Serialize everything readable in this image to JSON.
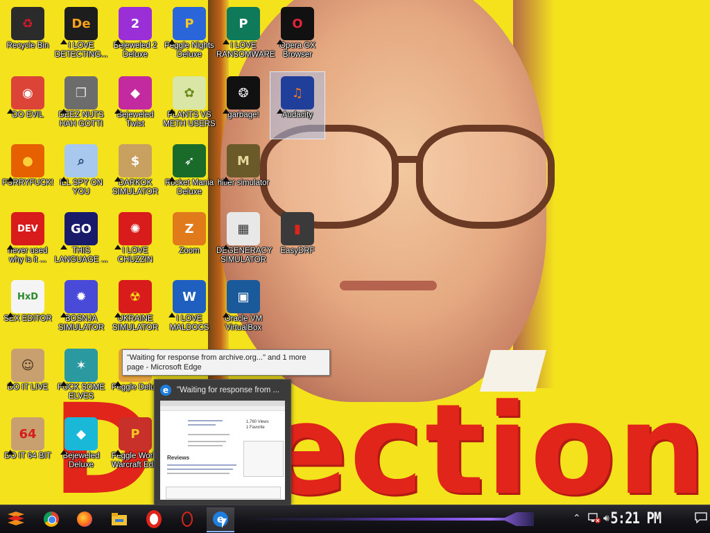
{
  "desktop": {
    "icons": [
      {
        "label": "Recycle Bin",
        "glyph": "recycle-bin-icon",
        "bg": "#2b2b2b",
        "fg": "#d81b2a",
        "text": "♻",
        "shortcut": false
      },
      {
        "label": "I LOVE DETECTING...",
        "glyph": "app-de-icon",
        "bg": "#1d1d1d",
        "fg": "#f7a21b",
        "text": "De",
        "shortcut": true
      },
      {
        "label": "Bejeweled 2 Deluxe",
        "glyph": "bejeweled-2-icon",
        "bg": "#9a2fd8",
        "fg": "#fff",
        "text": "2",
        "shortcut": true
      },
      {
        "label": "Peggle Nights Deluxe",
        "glyph": "peggle-icon",
        "bg": "#2a66d9",
        "fg": "#f7c623",
        "text": "P",
        "shortcut": true
      },
      {
        "label": "I LOVE RANSOMWARE",
        "glyph": "publisher-icon",
        "bg": "#0e7a5a",
        "fg": "#fff",
        "text": "P",
        "shortcut": true
      },
      {
        "label": "Opera GX Browser",
        "glyph": "opera-gx-icon",
        "bg": "#111",
        "fg": "#e0243a",
        "text": "O",
        "shortcut": true
      },
      {
        "label": "DO EVIL",
        "glyph": "chrome-icon",
        "bg": "#db4437",
        "fg": "#fff",
        "text": "◉",
        "shortcut": true
      },
      {
        "label": "DEEZ NUTS HAH GOTTI",
        "glyph": "stack-windows-icon",
        "bg": "#6c6c6c",
        "fg": "#ddd",
        "text": "❐",
        "shortcut": true
      },
      {
        "label": "Bejeweled Twist",
        "glyph": "bejeweled-twist-icon",
        "bg": "#c42aa0",
        "fg": "#fff",
        "text": "◆",
        "shortcut": true
      },
      {
        "label": "PLANTS VS METH USERS",
        "glyph": "plants-icon",
        "bg": "#d9e6a5",
        "fg": "#6a8a1a",
        "text": "✿",
        "shortcut": true
      },
      {
        "label": "garbage!",
        "glyph": "dragon-icon",
        "bg": "#111",
        "fg": "#e8e8e8",
        "text": "❂",
        "shortcut": true
      },
      {
        "label": "Audacity",
        "glyph": "audacity-icon",
        "bg": "#1f3f9a",
        "fg": "#ff7a1a",
        "text": "♫",
        "shortcut": true
      },
      {
        "label": "FURRYFUCK!",
        "glyph": "firefox-icon",
        "bg": "#e66000",
        "fg": "#ffcf3a",
        "text": "●",
        "shortcut": true
      },
      {
        "label": "ILL SPY ON YOU",
        "glyph": "magnifier-icon",
        "bg": "#a8c8ee",
        "fg": "#2a4a7a",
        "text": "⌕",
        "shortcut": true
      },
      {
        "label": "DARKOK SIMULATOR",
        "glyph": "money-bag-icon",
        "bg": "#c8a060",
        "fg": "#fff",
        "text": "$",
        "shortcut": true
      },
      {
        "label": "Rocket Mania Deluxe",
        "glyph": "rocket-icon",
        "bg": "#1a6a2a",
        "fg": "#fff",
        "text": "➶",
        "shortcut": true
      },
      {
        "label": "hitler simulator",
        "glyph": "coin-icon",
        "bg": "#6a5a2a",
        "fg": "#e8d79a",
        "text": "M",
        "shortcut": true
      },
      {
        "label": "never used why is it ...",
        "glyph": "devcpp-icon",
        "bg": "#d81b1b",
        "fg": "#fff",
        "text": "DEV",
        "shortcut": true
      },
      {
        "label": "THIS LANGUAGE ...",
        "glyph": "goland-icon",
        "bg": "#1a1a6a",
        "fg": "#fff",
        "text": "GO",
        "shortcut": true
      },
      {
        "label": "I LOVE CHUZZIN",
        "glyph": "chuzzle-icon",
        "bg": "#d81b1b",
        "fg": "#fff",
        "text": "✺",
        "shortcut": true
      },
      {
        "label": "Zoom",
        "glyph": "zoom-icon",
        "bg": "#e07a1a",
        "fg": "#fff",
        "text": "Z",
        "shortcut": false
      },
      {
        "label": "DEGENERACY SIMULATOR",
        "glyph": "windows-stack-icon",
        "bg": "#e8e8e8",
        "fg": "#333",
        "text": "▦",
        "shortcut": true
      },
      {
        "label": "EasyDRF",
        "glyph": "drive-icon",
        "bg": "#3a3a3a",
        "fg": "#e0241b",
        "text": "▮",
        "shortcut": false
      },
      {
        "label": "SEX EDITOR",
        "glyph": "hxd-icon",
        "bg": "#f4f4f4",
        "fg": "#2a8a2a",
        "text": "HxD",
        "shortcut": true
      },
      {
        "label": "BOSNJA SIMULATOR",
        "glyph": "mine-icon",
        "bg": "#4a4ad8",
        "fg": "#fff",
        "text": "✹",
        "shortcut": true
      },
      {
        "label": "UKRAINE SIMULATOR",
        "glyph": "radiation-icon",
        "bg": "#d81b1b",
        "fg": "#f7e01b",
        "text": "☢",
        "shortcut": true
      },
      {
        "label": "I LOVE MALDOCS",
        "glyph": "word-icon",
        "bg": "#1f5fbf",
        "fg": "#fff",
        "text": "W",
        "shortcut": true
      },
      {
        "label": "Oracle VM VirtualBox",
        "glyph": "virtualbox-icon",
        "bg": "#1a5a9a",
        "fg": "#fff",
        "text": "▣",
        "shortcut": true
      },
      {
        "label": "DO IT LIVE",
        "glyph": "portrait-icon",
        "bg": "#c8a070",
        "fg": "#3a2a1a",
        "text": "☺",
        "shortcut": true
      },
      {
        "label": "FUCK SOME ELVES",
        "glyph": "elf-icon",
        "bg": "#2a9aa0",
        "fg": "#fff",
        "text": "✶",
        "shortcut": true
      },
      {
        "label": "Peggle Delux",
        "glyph": "peggle-deluxe-icon",
        "bg": "#e0a03a",
        "fg": "#fff",
        "text": "P",
        "shortcut": true
      },
      {
        "label": "DO IT 64 BIT",
        "glyph": "portrait-64-icon",
        "bg": "#c8a070",
        "fg": "#d81b1b",
        "text": "64",
        "shortcut": true
      },
      {
        "label": "Bejeweled Deluxe",
        "glyph": "diamond-icon",
        "bg": "#1ab8d8",
        "fg": "#fff",
        "text": "◆",
        "shortcut": true
      },
      {
        "label": "Peggle World Warcraft Editi",
        "glyph": "peggle-wow-icon",
        "bg": "#c8302a",
        "fg": "#f7c623",
        "text": "P",
        "shortcut": true
      }
    ]
  },
  "tooltip": {
    "text": "\"Waiting for response from archive.org...\" and 1 more page - Microsoft Edge"
  },
  "preview": {
    "title": "\"Waiting for response from ...",
    "page": {
      "heading": "Reviews",
      "views": "1,760 Views",
      "favorite": "1 Favorite"
    }
  },
  "taskbar": {
    "clock": "5:21 PM",
    "apps": [
      {
        "name": "start-menu-icon",
        "label": "Start"
      },
      {
        "name": "chrome-icon",
        "label": "Chrome"
      },
      {
        "name": "firefox-icon",
        "label": "Firefox"
      },
      {
        "name": "file-explorer-icon",
        "label": "File Explorer"
      },
      {
        "name": "opera-icon",
        "label": "Opera"
      },
      {
        "name": "opera-gx-icon",
        "label": "Opera GX"
      },
      {
        "name": "edge-icon",
        "label": "Microsoft Edge"
      }
    ]
  },
  "colors": {
    "wallpaper": "#f4e21c",
    "wallpaper_text": "#e2251b",
    "taskbar": "#15151a",
    "accent": "#8ab4f8"
  }
}
